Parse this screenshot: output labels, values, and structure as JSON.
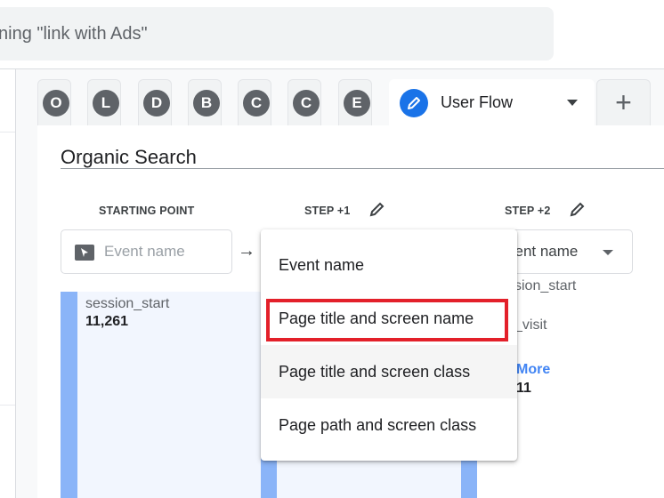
{
  "search": {
    "text": "ning \"link with Ads\""
  },
  "tabs": [
    {
      "letter": "O"
    },
    {
      "letter": "L"
    },
    {
      "letter": "D"
    },
    {
      "letter": "B"
    },
    {
      "letter": "C"
    },
    {
      "letter": "C"
    },
    {
      "letter": "E"
    }
  ],
  "active_tab": {
    "label": "User Flow",
    "icon": "pencil-icon"
  },
  "add_tab": {
    "label": "+"
  },
  "card": {
    "title": "Organic Search",
    "columns": [
      {
        "header": "STARTING POINT",
        "field_placeholder": "Event name"
      },
      {
        "header": "STEP +1"
      },
      {
        "header": "STEP +2",
        "field_value": "vent name"
      }
    ],
    "start_node": {
      "name": "session_start",
      "value": "11,261"
    },
    "step2_nodes": [
      {
        "name": "sion_start"
      },
      {
        "name": "_visit"
      },
      {
        "name": "More",
        "value": "11"
      }
    ]
  },
  "menu": {
    "items": [
      "Event name",
      "Page title and screen name",
      "Page title and screen class",
      "Page path and screen class"
    ],
    "highlighted_index": 1,
    "hovered_index": 2
  },
  "colors": {
    "accent": "#1a73e8",
    "bar": "#8ab4f8",
    "highlight_box": "#e3202a"
  }
}
